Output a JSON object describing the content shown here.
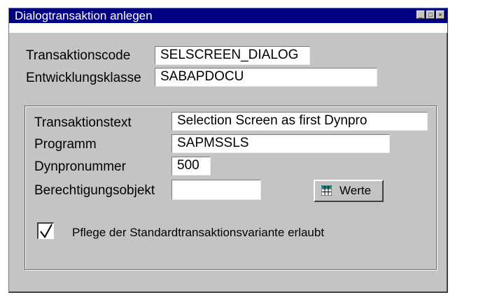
{
  "window": {
    "title": "Dialogtransaktion anlegen",
    "controls": {
      "minimize": "_",
      "maximize": "□",
      "close": "×"
    }
  },
  "header_fields": {
    "transaktionscode": {
      "label": "Transaktionscode",
      "value": "SELSCREEN_DIALOG"
    },
    "entwicklungsklasse": {
      "label": "Entwicklungsklasse",
      "value": "SABAPDOCU"
    }
  },
  "group": {
    "transaktionstext": {
      "label": "Transaktionstext",
      "value": "Selection Screen as first Dynpro"
    },
    "programm": {
      "label": "Programm",
      "value": "SAPMSSLS"
    },
    "dynpronummer": {
      "label": "Dynpronummer",
      "value": "500"
    },
    "berechtigungsobjekt": {
      "label": "Berechtigungsobjekt",
      "value": ""
    },
    "werte_button": {
      "label": "Werte",
      "icon": "table-icon"
    },
    "checkbox": {
      "label": "Pflege der Standardtransaktionsvariante erlaubt",
      "checked": true
    }
  },
  "colors": {
    "titlebar": "#000080",
    "window_bg": "#c4c4c4",
    "field_bg": "#ffffff"
  }
}
